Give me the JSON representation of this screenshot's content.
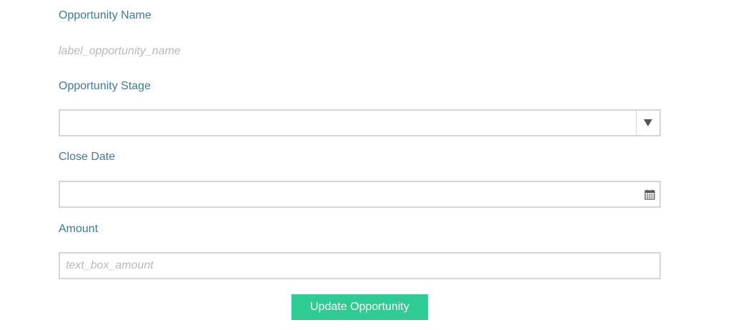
{
  "form": {
    "opportunity_name_label": "Opportunity Name",
    "opportunity_name_value": "label_opportunity_name",
    "opportunity_stage_label": "Opportunity Stage",
    "opportunity_stage_value": "",
    "close_date_label": "Close Date",
    "close_date_value": "",
    "amount_label": "Amount",
    "amount_placeholder": "text_box_amount",
    "amount_value": "",
    "update_button_label": "Update Opportunity"
  },
  "icons": {
    "stage_dropdown": "chevron-down-icon",
    "close_date_picker": "calendar-icon"
  },
  "colors": {
    "label": "#3f7a96",
    "placeholder": "#b9b9b9",
    "border": "#d5d5d5",
    "button_bg": "#2ecc94",
    "button_text": "#ffffff"
  }
}
